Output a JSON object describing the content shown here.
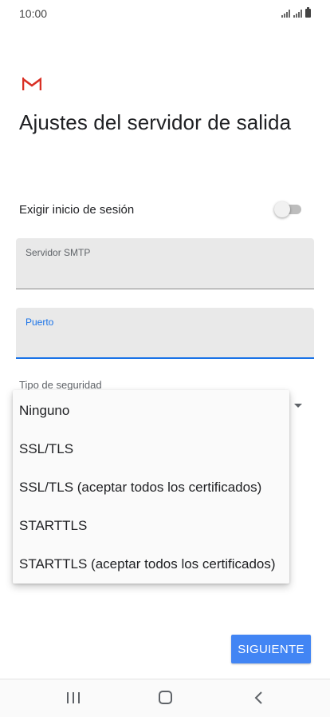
{
  "status_bar": {
    "time": "10:00"
  },
  "app": {
    "logo_icon": "gmail-logo-icon",
    "brand_color": "#d93025"
  },
  "page": {
    "title": "Ajustes del servidor de salida"
  },
  "login_toggle": {
    "label": "Exigir inicio de sesión",
    "state": "off"
  },
  "fields": {
    "smtp": {
      "label": "Servidor SMTP",
      "value": ""
    },
    "port": {
      "label": "Puerto",
      "value": ""
    }
  },
  "security": {
    "label": "Tipo de seguridad",
    "options": [
      "Ninguno",
      "SSL/TLS",
      "SSL/TLS (aceptar todos los certificados)",
      "STARTTLS",
      "STARTTLS (aceptar todos los certificados)"
    ]
  },
  "actions": {
    "next_label": "SIGUIENTE",
    "accent_color": "#4285f4"
  },
  "nav": {
    "recent_icon": "recent-apps-icon",
    "home_icon": "home-icon",
    "back_icon": "back-icon"
  }
}
